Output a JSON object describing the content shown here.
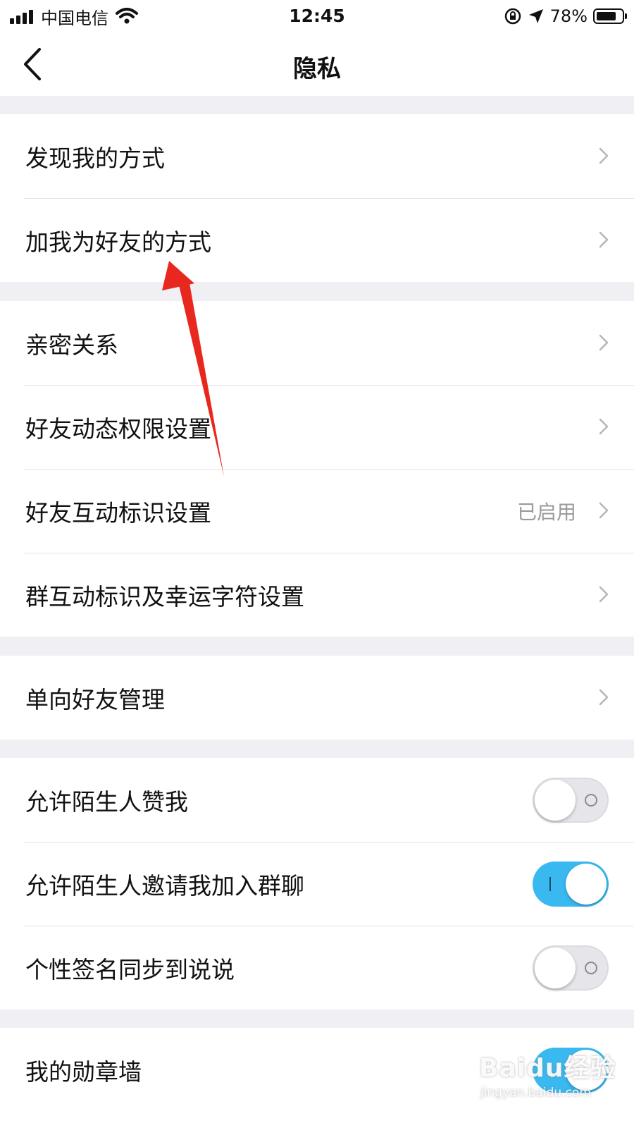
{
  "status_bar": {
    "carrier": "中国电信",
    "time": "12:45",
    "battery": "78%",
    "battery_level": 0.78
  },
  "nav": {
    "title": "隐私"
  },
  "groups": [
    {
      "rows": [
        {
          "label": "发现我的方式"
        },
        {
          "label": "加我为好友的方式"
        }
      ]
    },
    {
      "rows": [
        {
          "label": "亲密关系"
        },
        {
          "label": "好友动态权限设置"
        },
        {
          "label": "好友互动标识设置",
          "value": "已启用"
        },
        {
          "label": "群互动标识及幸运字符设置"
        }
      ]
    },
    {
      "rows": [
        {
          "label": "单向好友管理"
        }
      ]
    },
    {
      "rows": [
        {
          "label": "允许陌生人赞我",
          "toggle": "off"
        },
        {
          "label": "允许陌生人邀请我加入群聊",
          "toggle": "on"
        },
        {
          "label": "个性签名同步到说说",
          "toggle": "off"
        }
      ]
    },
    {
      "rows": [
        {
          "label": "我的勋章墙",
          "toggle": "on"
        }
      ]
    }
  ],
  "watermark": {
    "logo": "Baidu经验",
    "url": "jingyan.baidu.com"
  },
  "colors": {
    "toggle_on": "#3ab9f0",
    "annotation_arrow": "#e8281f",
    "background": "#efeff4"
  },
  "icons": [
    "signal-icon",
    "wifi-icon",
    "rotation-lock-icon",
    "location-icon",
    "battery-icon",
    "back-chevron-icon",
    "chevron-right-icon"
  ]
}
